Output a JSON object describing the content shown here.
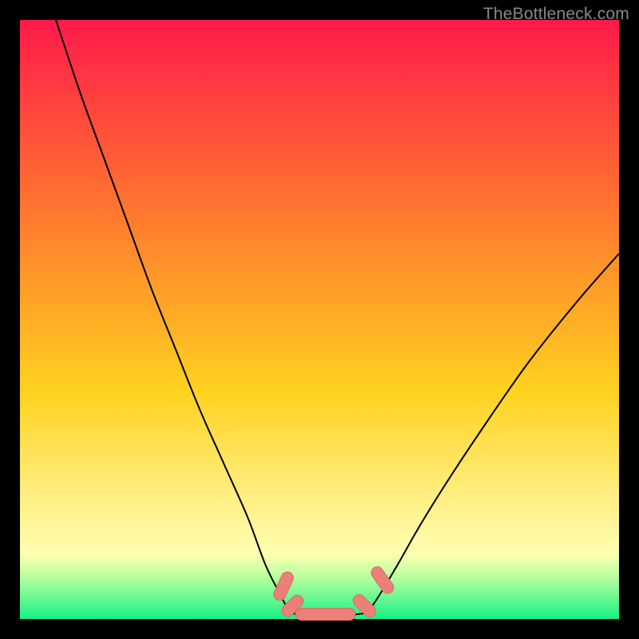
{
  "watermark_text": "TheBottleneck.com",
  "plot": {
    "inner_x_min": 25,
    "inner_x_max": 775,
    "inner_y_min": 25,
    "inner_y_max": 775
  },
  "colors": {
    "bg": "#000000",
    "grad_top": "#ff1a4a",
    "grad_mid1": "#ff7a2e",
    "grad_mid2": "#ffd21f",
    "grad_band_pale": "#ffffb0",
    "grad_green": "#17f185",
    "curve": "#000000",
    "marker_fill": "#ec8079",
    "marker_stroke": "#d96a63"
  },
  "chart_data": {
    "type": "line",
    "title": "",
    "xlabel": "",
    "ylabel": "",
    "xlim": [
      0,
      100
    ],
    "ylim": [
      0,
      100
    ],
    "series": [
      {
        "name": "left-curve",
        "x": [
          6,
          10,
          14,
          18,
          22,
          26,
          30,
          34,
          38,
          41,
          43.5,
          45
        ],
        "y": [
          100,
          88,
          77,
          66,
          55,
          45,
          35,
          26,
          17,
          9,
          4,
          1
        ]
      },
      {
        "name": "right-curve",
        "x": [
          58,
          60,
          63,
          67,
          72,
          78,
          85,
          93,
          100
        ],
        "y": [
          1,
          4,
          9,
          16,
          24,
          33,
          43,
          53,
          61
        ]
      },
      {
        "name": "bottom-flat",
        "x": [
          45,
          49,
          53,
          58
        ],
        "y": [
          1,
          0.5,
          0.5,
          1
        ]
      }
    ],
    "markers": [
      {
        "name": "m-left-1",
        "x": 44.0,
        "y": 5.5,
        "len": 5.0,
        "angle": -65
      },
      {
        "name": "m-left-2",
        "x": 45.5,
        "y": 2.2,
        "len": 4.2,
        "angle": -45
      },
      {
        "name": "m-bottom",
        "x": 51.0,
        "y": 0.8,
        "len": 10.0,
        "angle": 0
      },
      {
        "name": "m-right-1",
        "x": 57.5,
        "y": 2.2,
        "len": 4.5,
        "angle": 45
      },
      {
        "name": "m-right-2",
        "x": 60.5,
        "y": 6.5,
        "len": 5.0,
        "angle": 55
      }
    ]
  }
}
